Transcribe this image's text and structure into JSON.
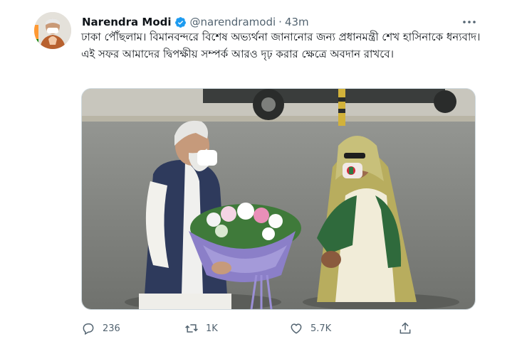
{
  "author": {
    "name": "Narendra Modi",
    "handle": "@narendramodi",
    "separator": "·",
    "time": "43m"
  },
  "tweet": {
    "text": "ঢাকা পৌঁছলাম। বিমানবন্দরে বিশেষ অভ্যর্থনা জানানোর জন্য প্রধানমন্ত্রী শেখ হাসিনাকে ধন্যবাদ। এই সফর আমাদের দ্বিপক্ষীয় সম্পর্ক আরও দৃঢ় করার ক্ষেত্রে অবদান রাখবে।"
  },
  "stats": {
    "replies": "236",
    "retweets": "1K",
    "likes": "5.7K"
  },
  "icons": {
    "verified": "verified-badge-icon",
    "more": "more-options-icon",
    "reply": "reply-icon",
    "retweet": "retweet-icon",
    "like": "heart-icon",
    "share": "share-icon"
  },
  "colors": {
    "verified": "#1d9bf0",
    "muted": "#536471"
  }
}
